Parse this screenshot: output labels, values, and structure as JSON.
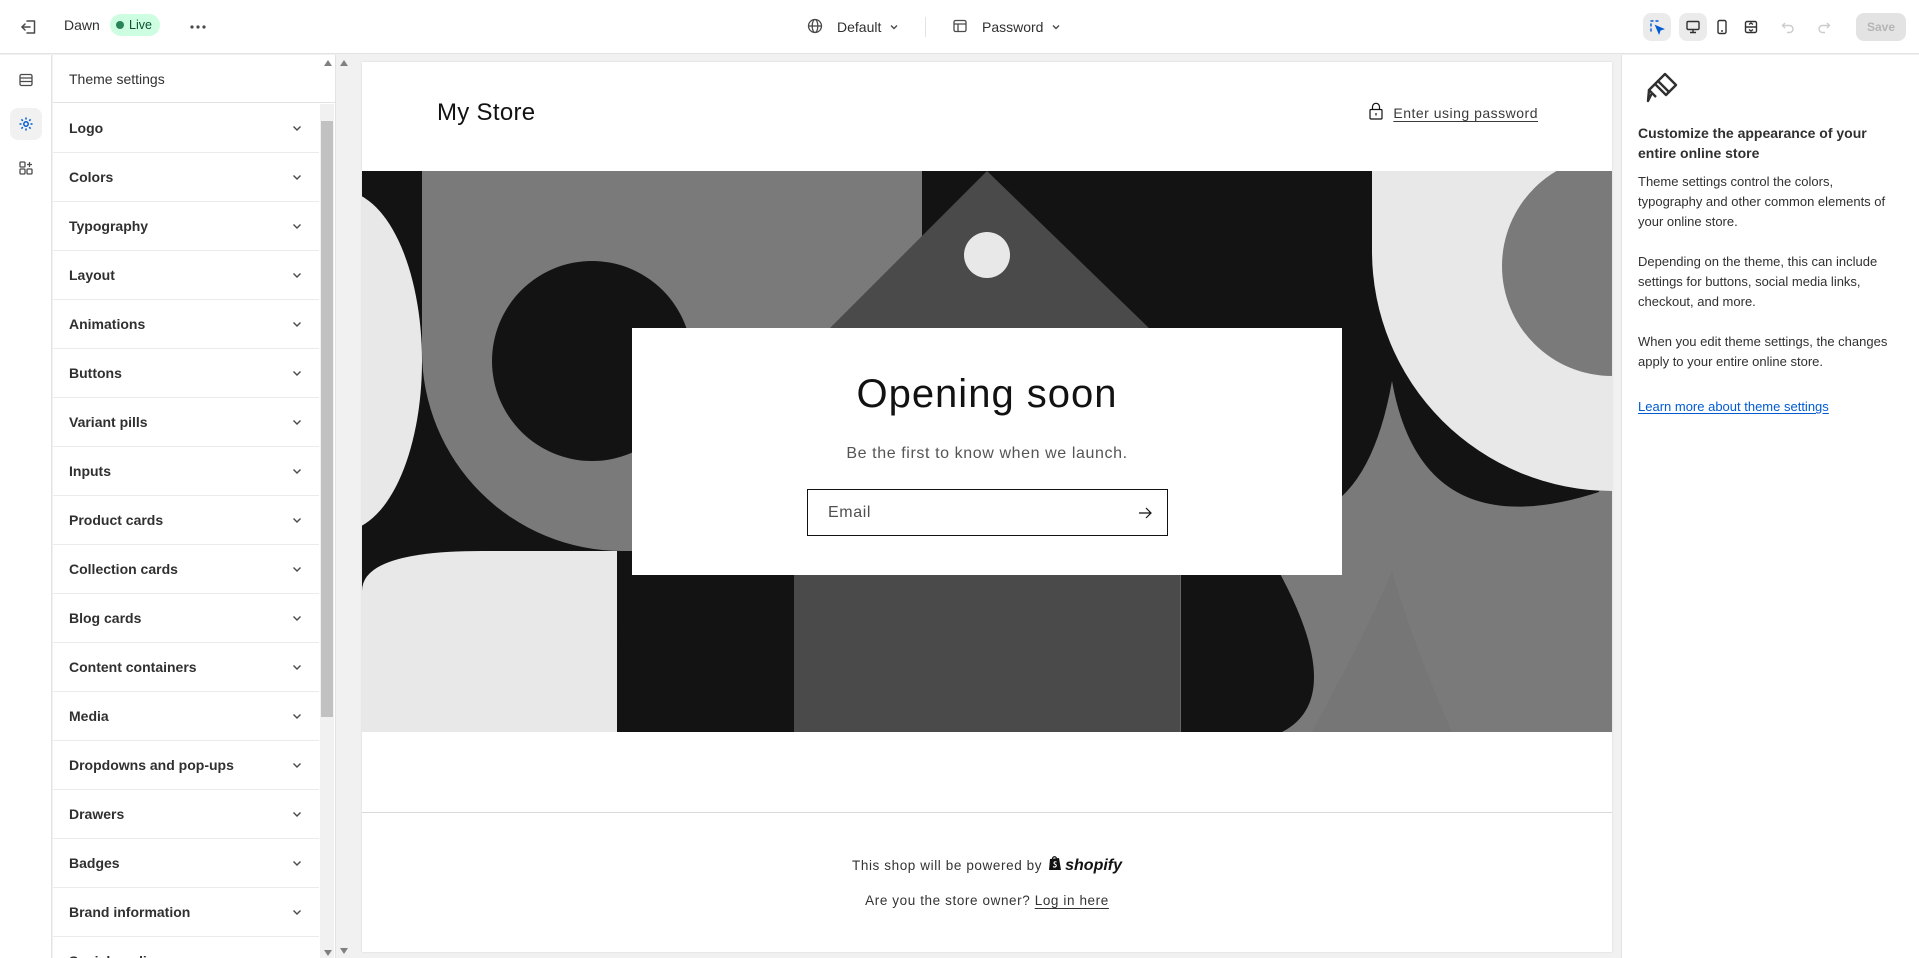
{
  "topbar": {
    "theme_name": "Dawn",
    "status_badge": "Live",
    "template_select": "Default",
    "page_select": "Password",
    "save_label": "Save"
  },
  "sidebar": {
    "title": "Theme settings",
    "items": [
      "Logo",
      "Colors",
      "Typography",
      "Layout",
      "Animations",
      "Buttons",
      "Variant pills",
      "Inputs",
      "Product cards",
      "Collection cards",
      "Blog cards",
      "Content containers",
      "Media",
      "Dropdowns and pop-ups",
      "Drawers",
      "Badges",
      "Brand information",
      "Social media"
    ]
  },
  "preview": {
    "store_name": "My Store",
    "enter_password": "Enter using password",
    "hero_title": "Opening soon",
    "hero_subtitle": "Be the first to know when we launch.",
    "email_placeholder": "Email",
    "powered_by": "This shop will be powered by",
    "shopify_brand": "shopify",
    "owner_question": "Are you the store owner?",
    "login_link": "Log in here"
  },
  "info_panel": {
    "heading": "Customize the appearance of your entire online store",
    "paragraph1": "Theme settings control the colors, typography and other common elements of your online store.",
    "paragraph2": "Depending on the theme, this can include settings for buttons, social media links, checkout, and more.",
    "paragraph3": "When you edit theme settings, the changes apply to your entire online store.",
    "learn_more": "Learn more about theme settings"
  },
  "colors": {
    "accent": "#005bd3",
    "live_badge_bg": "#cdfee1",
    "live_dot": "#29845a"
  },
  "icons": [
    "exit-icon",
    "more-icon",
    "globe-icon",
    "layout-icon",
    "chevron-down-icon",
    "inspector-icon",
    "desktop-icon",
    "mobile-icon",
    "fullscreen-icon",
    "undo-icon",
    "redo-icon",
    "sections-icon",
    "gear-icon",
    "apps-icon",
    "lock-icon",
    "arrow-right-icon",
    "paintbrush-icon"
  ]
}
